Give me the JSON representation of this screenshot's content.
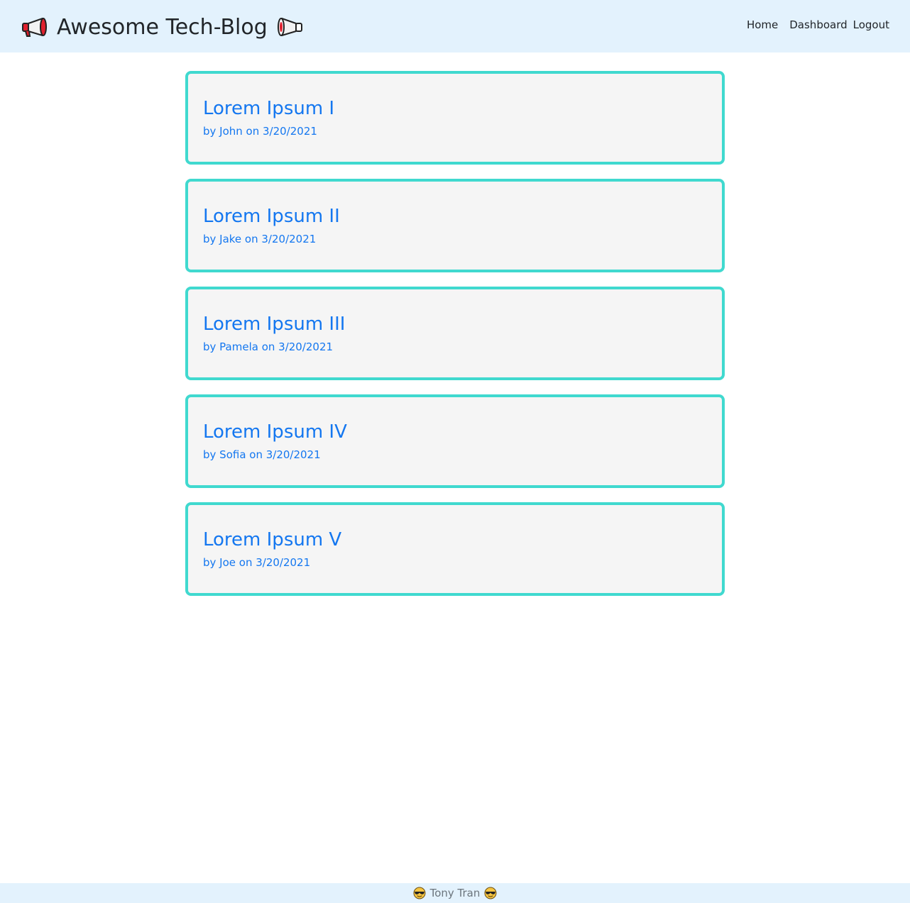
{
  "navbar": {
    "brand": {
      "left_icon": "megaphone-icon",
      "title": "Awesome Tech-Blog",
      "right_icon": "megaphone-icon"
    },
    "links": [
      {
        "label": "Home"
      },
      {
        "label": "Dashboard"
      },
      {
        "label": "Logout"
      }
    ]
  },
  "posts": [
    {
      "title": "Lorem Ipsum I",
      "meta": "by John on 3/20/2021"
    },
    {
      "title": "Lorem Ipsum II",
      "meta": "by Jake on 3/20/2021"
    },
    {
      "title": "Lorem Ipsum III",
      "meta": "by Pamela on 3/20/2021"
    },
    {
      "title": "Lorem Ipsum IV",
      "meta": "by Sofia on 3/20/2021"
    },
    {
      "title": "Lorem Ipsum V",
      "meta": "by Joe on 3/20/2021"
    }
  ],
  "footer": {
    "left_icon": "sunglasses-face-icon",
    "text": "Tony Tran",
    "right_icon": "sunglasses-face-icon"
  },
  "colors": {
    "navbar_bg": "#e3f2fd",
    "card_border": "#40d9cf",
    "card_bg": "#f5f5f5",
    "link_blue": "#1477f0"
  }
}
